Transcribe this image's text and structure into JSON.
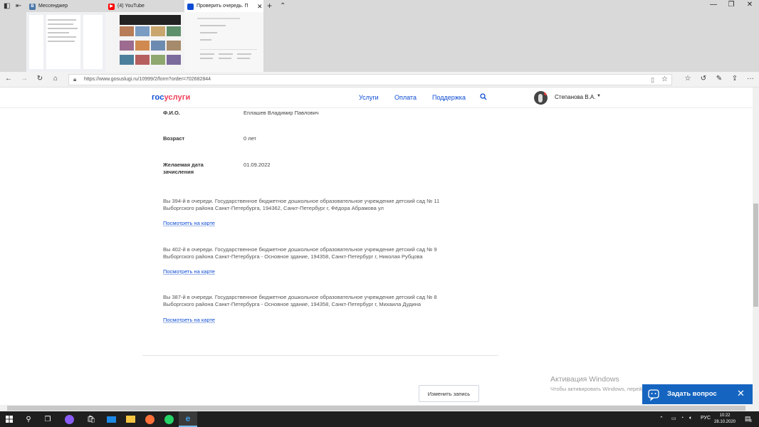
{
  "browser": {
    "tabs": [
      {
        "title": "Мессенджер",
        "icon": "vk-icon",
        "color": "#4a76a8"
      },
      {
        "title": "(4) YouTube",
        "icon": "youtube-icon",
        "color": "#ff0000"
      },
      {
        "title": "Проверить очередь. П",
        "icon": "gosuslugi-icon",
        "color": "#0d4cd3",
        "active": true
      }
    ],
    "url": "https://www.gosuslugi.ru/10999/2/form?order=702682844",
    "window_controls": [
      "minimize",
      "maximize",
      "close"
    ]
  },
  "site": {
    "logo_part1": "гос",
    "logo_part2": "услуги",
    "nav": [
      "Услуги",
      "Оплата",
      "Поддержка"
    ],
    "user_name": "Степанова В.А.",
    "accent": "#0d4cd3",
    "logo_accent": "#ee3f58"
  },
  "details": {
    "fio_label": "Ф.И.О.",
    "fio_value": "Еплашев Владимир Павлович",
    "age_label": "Возраст",
    "age_value": "0 лет",
    "date_label": "Желаемая дата зачисления",
    "date_value": "01.09.2022"
  },
  "queue": [
    {
      "text": "Вы 394-й в очереди. Государственное бюджетное дошкольное образовательное учреждение детский сад № 11 Выборгского района Санкт-Петербурга, 194362, Санкт-Петербург г, Фёдора Абрамова ул",
      "link": "Посмотреть на карте"
    },
    {
      "text": "Вы 402-й в очереди. Государственное бюджетное дошкольное образовательное учреждение детский сад № 9 Выборгского района Санкт-Петербурга - Основное здание, 194358, Санкт-Петербург г, Николая Рубцова",
      "link": "Посмотреть на карте"
    },
    {
      "text": "Вы 387-й в очереди. Государственное бюджетное дошкольное образовательное учреждение детский сад № 8 Выборгского района Санкт-Петербурга - Основное здание, 194358, Санкт-Петербург г, Михаила Дудина",
      "link": "Посмотреть на карте"
    }
  ],
  "actions": {
    "change_button": "Изменить запись"
  },
  "windows_activation": {
    "title": "Активация Windows",
    "subtitle": "Чтобы активировать Windows, перейдите в раздел \"Параметры\"."
  },
  "ask_widget": {
    "label": "Задать вопрос",
    "color": "#1565c0"
  },
  "taskbar": {
    "lang": "РУС",
    "time": "10:22",
    "date": "28.10.2020",
    "notification_count": "3"
  }
}
